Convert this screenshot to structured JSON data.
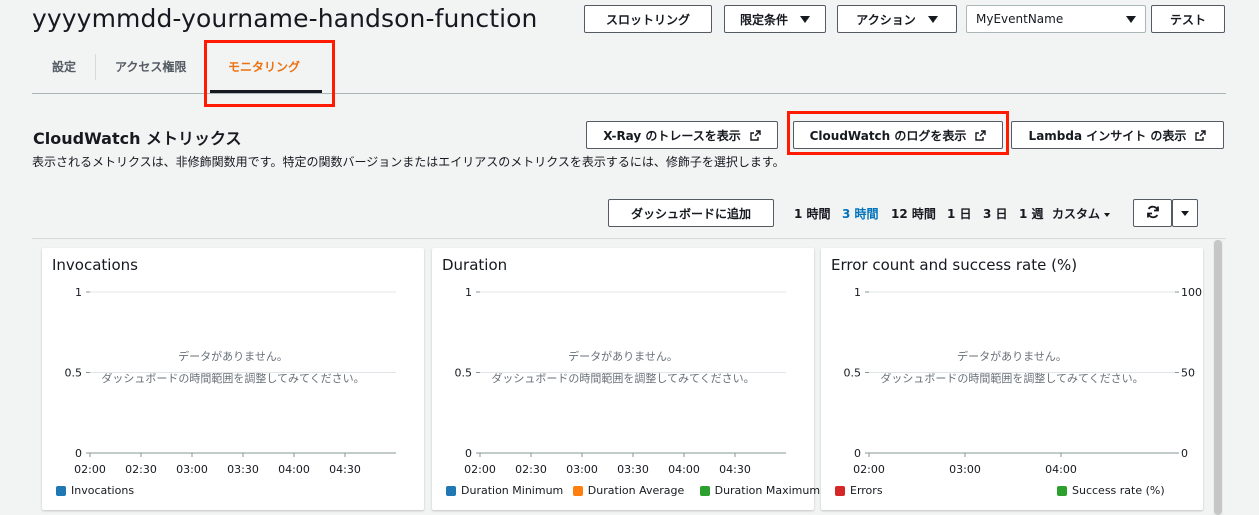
{
  "header": {
    "title": "yyyymmdd-yourname-handson-function",
    "throttle_label": "スロットリング",
    "qualifiers_label": "限定条件",
    "actions_label": "アクション",
    "event_select_value": "MyEventName",
    "test_label": "テスト"
  },
  "tabs": [
    {
      "label": "設定"
    },
    {
      "label": "アクセス権限"
    },
    {
      "label": "モニタリング"
    }
  ],
  "section": {
    "title": "CloudWatch メトリックス",
    "description": "表示されるメトリクスは、非修飾関数用です。特定の関数バージョンまたはエイリアスのメトリクスを表示するには、修飾子を選択します。",
    "xray_label": "X-Ray のトレースを表示",
    "logs_label": "CloudWatch のログを表示",
    "insights_label": "Lambda インサイト の表示"
  },
  "toolbar": {
    "add_dashboard_label": "ダッシュボードに追加",
    "ranges": [
      "1 時間",
      "3 時間",
      "12 時間",
      "1 日",
      "3 日",
      "1 週",
      "カスタム"
    ],
    "active_range": "3 時間"
  },
  "nodata": {
    "line1": "データがありません。",
    "line2": "ダッシュボードの時間範囲を調整してみてください。"
  },
  "colors": {
    "accent_orange": "#ec7211",
    "link_blue": "#0073bb",
    "highlight_red": "#ff1a00"
  },
  "chart_data": [
    {
      "type": "line",
      "title": "Invocations",
      "ylim": [
        0,
        1
      ],
      "yticks": [
        "1",
        "0.5",
        "0"
      ],
      "x": [
        "02:00",
        "02:30",
        "03:00",
        "03:30",
        "04:00",
        "04:30"
      ],
      "series": [
        {
          "name": "Invocations",
          "color": "#1f77b4",
          "values": []
        }
      ],
      "legend": "bottom-left"
    },
    {
      "type": "line",
      "title": "Duration",
      "ylim": [
        0,
        1
      ],
      "yticks": [
        "1",
        "0.5",
        "0"
      ],
      "x": [
        "02:00",
        "02:30",
        "03:00",
        "03:30",
        "04:00",
        "04:30"
      ],
      "series": [
        {
          "name": "Duration Minimum",
          "color": "#1f77b4",
          "values": []
        },
        {
          "name": "Duration Average",
          "color": "#ff7f0e",
          "values": []
        },
        {
          "name": "Duration Maximum",
          "color": "#2ca02c",
          "values": []
        }
      ],
      "legend": "bottom-left"
    },
    {
      "type": "line",
      "title": "Error count and success rate (%)",
      "ylim": [
        0,
        1
      ],
      "yticks": [
        "1",
        "0.5",
        "0"
      ],
      "y2lim": [
        0,
        100
      ],
      "y2ticks": [
        "100",
        "50",
        "0"
      ],
      "x": [
        "02:00",
        "03:00",
        "04:00"
      ],
      "series": [
        {
          "name": "Errors",
          "color": "#d62728",
          "values": []
        },
        {
          "name": "Success rate (%)",
          "color": "#2ca02c",
          "values": []
        }
      ],
      "legend": "bottom"
    }
  ]
}
